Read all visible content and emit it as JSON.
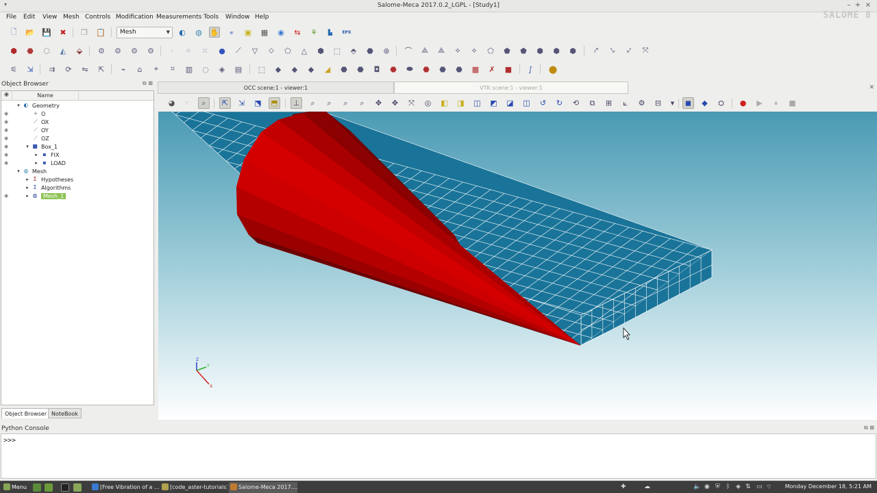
{
  "window": {
    "title": "Salome-Meca 2017.0.2_LGPL - [Study1]",
    "logo_text": "SALOME 8"
  },
  "menubar": {
    "items": [
      "File",
      "Edit",
      "View",
      "Mesh",
      "Controls",
      "Modification",
      "Measurements",
      "Tools",
      "Window",
      "Help"
    ]
  },
  "toolbar": {
    "module": "Mesh",
    "module_icon": "hand-icon"
  },
  "object_browser": {
    "title": "Object Browser",
    "column_name": "Name",
    "tree": [
      {
        "label": "Geometry",
        "icon": "geometry-icon"
      },
      {
        "label": "O",
        "icon": "point-icon"
      },
      {
        "label": "OX",
        "icon": "vector-icon"
      },
      {
        "label": "OY",
        "icon": "vector-icon"
      },
      {
        "label": "OZ",
        "icon": "vector-icon"
      },
      {
        "label": "Box_1",
        "icon": "box-icon"
      },
      {
        "label": "FIX",
        "icon": "group-icon"
      },
      {
        "label": "LOAD",
        "icon": "group-icon"
      },
      {
        "label": "Mesh",
        "icon": "mesh-module-icon"
      },
      {
        "label": "Hypotheses",
        "icon": "hypotheses-icon"
      },
      {
        "label": "Algorithms",
        "icon": "algorithms-icon"
      },
      {
        "label": "Mesh_1",
        "icon": "mesh-icon"
      }
    ],
    "tabs": [
      "Object Browser",
      "NoteBook"
    ]
  },
  "viewer": {
    "tabs": [
      "OCC scene:1 - viewer:1",
      "VTK scene:1 - viewer:1"
    ],
    "mesh_color": "#1a7499",
    "mesh_line_color": "#ffffff",
    "cone_color": "#cc0000",
    "bg_top": "#4a9ab4",
    "bg_bottom": "#ffffff",
    "axes": {
      "x": "X",
      "y": "Y",
      "z": "Z"
    }
  },
  "console": {
    "title": "Python Console",
    "prompt": ">>>"
  },
  "taskbar": {
    "menu_label": "Menu",
    "windows": [
      "[Free Vibration of a ...",
      "[code_aster-tutorials]",
      "Salome-Meca 2017...."
    ],
    "clock": "Monday December 18, 5:21 AM"
  }
}
